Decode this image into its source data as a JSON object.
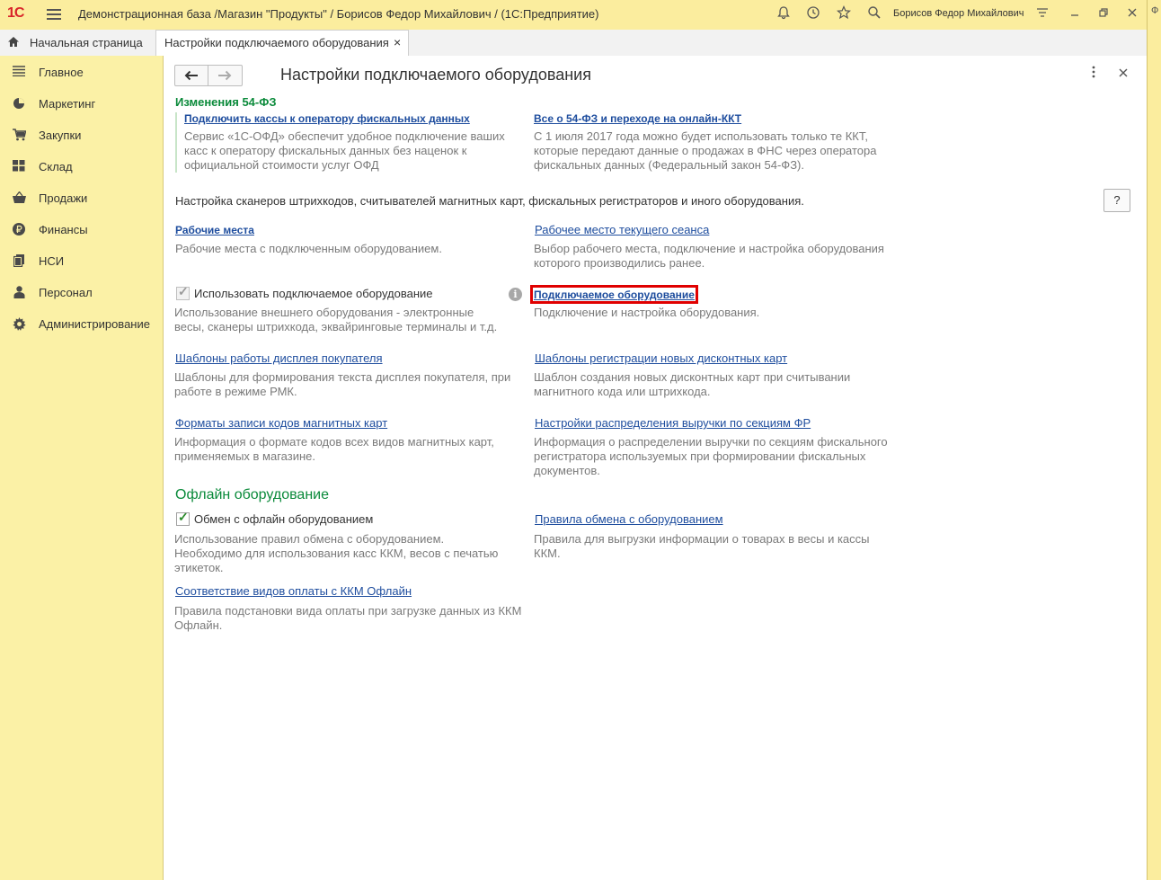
{
  "titlebar": {
    "logo": "1С",
    "title": "Демонстрационная база /Магазин \"Продукты\" / Борисов Федор Михайлович /  (1С:Предприятие)",
    "user": "Борисов Федор Михайлович"
  },
  "right_strip": {
    "letter": "Ф"
  },
  "tabs": {
    "home_label": "Начальная страница",
    "active_label": "Настройки подключаемого оборудования",
    "close": "×"
  },
  "sidebar": {
    "items": [
      {
        "label": "Главное",
        "icon": "list-icon"
      },
      {
        "label": "Маркетинг",
        "icon": "pie-chart-icon"
      },
      {
        "label": "Закупки",
        "icon": "cart-icon"
      },
      {
        "label": "Склад",
        "icon": "warehouse-grid-icon"
      },
      {
        "label": "Продажи",
        "icon": "basket-icon"
      },
      {
        "label": "Финансы",
        "icon": "ruble-icon"
      },
      {
        "label": "НСИ",
        "icon": "documents-icon"
      },
      {
        "label": "Персонал",
        "icon": "person-icon"
      },
      {
        "label": "Администрирование",
        "icon": "gear-icon"
      }
    ]
  },
  "page": {
    "title": "Настройки подключаемого оборудования",
    "help": "?",
    "fz_header": "Изменения 54-ФЗ",
    "fz_left_link": "Подключить кассы к оператору фискальных данных",
    "fz_left_desc": "Сервис  «1С-ОФД» обеспечит удобное подключение ваших касс к оператору фискальных данных без наценок к официальной стоимости услуг ОФД",
    "fz_right_link": "Все о 54-ФЗ и переходе на онлайн-ККТ",
    "fz_right_desc": "С 1 июля 2017 года можно будет использовать только те ККТ, которые передают данные о продажах в ФНС через оператора фискальных данных (Федеральный закон 54-ФЗ).",
    "intro": "Настройка сканеров штрихкодов, считывателей магнитных карт, фискальных регистраторов и иного оборудования.",
    "workplaces_link": "Рабочие места",
    "workplaces_desc": "Рабочие места с подключенным оборудованием.",
    "current_workplace_link": "Рабочее место текущего сеанса",
    "current_workplace_desc": "Выбор рабочего места, подключение и настройка оборудования которого производились ранее.",
    "use_equipment_label": "Использовать подключаемое оборудование",
    "use_equipment_checked": true,
    "use_equipment_desc": "Использование внешнего оборудования - электронные весы, сканеры штрихкода, эквайринговые терминалы и т.д.",
    "info": "i",
    "equipment_link": "Подключаемое оборудование",
    "equipment_desc": "Подключение и настройка оборудования.",
    "display_templates_link": "Шаблоны работы дисплея покупателя",
    "display_templates_desc": "Шаблоны для формирования текста дисплея покупателя, при работе в режиме РМК.",
    "discount_templates_link": "Шаблоны регистрации новых дисконтных карт",
    "discount_templates_desc": "Шаблон создания новых дисконтных карт при считывании магнитного кода или штрихкода.",
    "card_formats_link": "Форматы записи кодов магнитных карт",
    "card_formats_desc": "Информация о формате кодов всех видов магнитных карт, применяемых в магазине.",
    "revenue_link": "Настройки распределения выручки по секциям ФР",
    "revenue_desc": "Информация о распределении выручки по секциям фискального регистратора используемых при формировании фискальных документов.",
    "offline_header": "Офлайн оборудование",
    "offline_exchange_label": "Обмен с офлайн оборудованием",
    "offline_exchange_checked": true,
    "offline_exchange_desc": "Использование правил обмена с оборудованием. Необходимо для использования касс ККМ, весов с печатью этикеток.",
    "exchange_rules_link": "Правила обмена с оборудованием",
    "exchange_rules_desc": "Правила для выгрузки информации о товарах в весы и кассы ККМ.",
    "payment_match_link": "Соответствие видов оплаты с ККМ Офлайн",
    "payment_match_desc": "Правила подстановки вида оплаты при загрузке данных из ККМ Офлайн."
  }
}
